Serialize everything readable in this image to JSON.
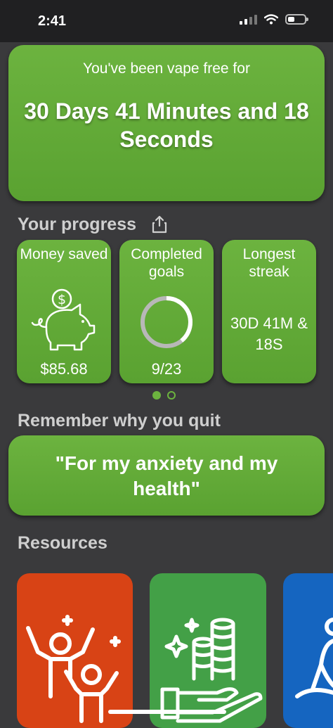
{
  "status_bar": {
    "time": "2:41"
  },
  "hero": {
    "label": "You've been vape free for",
    "duration": "30 Days 41 Minutes and 18 Seconds"
  },
  "progress": {
    "title": "Your progress",
    "cards": [
      {
        "label": "Money saved",
        "value": "$85.68",
        "icon": "piggy-bank-icon"
      },
      {
        "label": "Completed goals",
        "value": "9/23",
        "completed": 9,
        "total": 23
      },
      {
        "label": "Longest streak",
        "value": "30D 41M & 18S"
      }
    ],
    "pager": {
      "pages": 2,
      "active": 1
    }
  },
  "reasons": {
    "title": "Remember why you quit",
    "quote": "\"For my anxiety and my health\""
  },
  "resources": {
    "title": "Resources",
    "cards": [
      {
        "icon": "celebrating-people-icon",
        "color": "#d84315"
      },
      {
        "icon": "savings-hand-icon",
        "color": "#43a047"
      },
      {
        "icon": "meditation-icon",
        "color": "#1565c0"
      }
    ]
  },
  "colors": {
    "accent": "#6cb33f",
    "background": "#3a3a3c"
  }
}
